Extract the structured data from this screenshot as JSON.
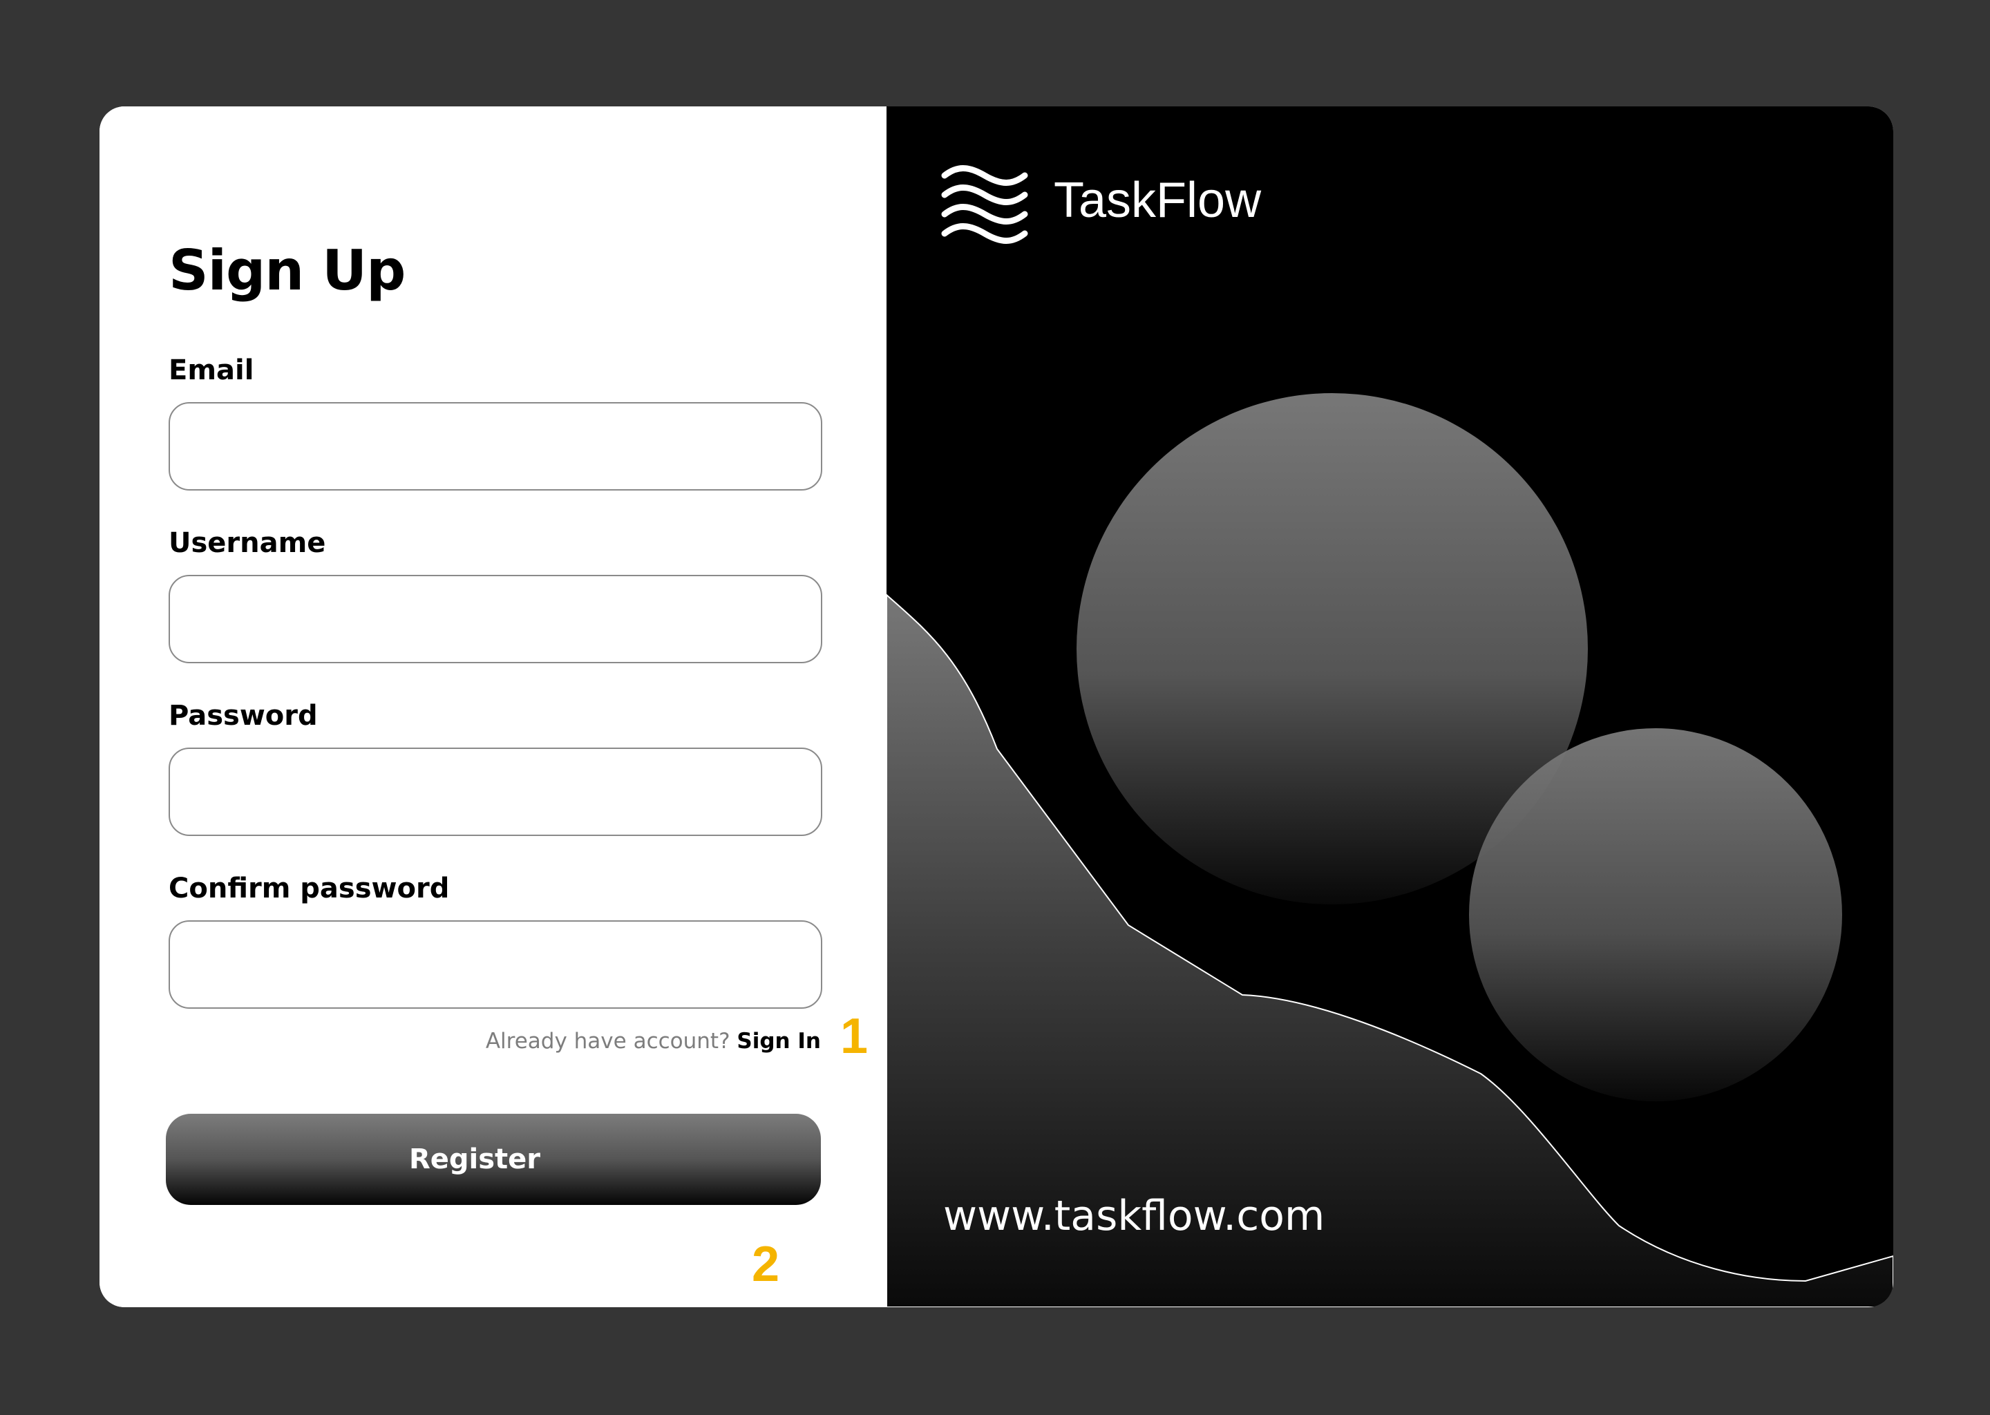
{
  "signup": {
    "title": "Sign Up",
    "fields": [
      {
        "label": "Email",
        "value": "",
        "placeholder": ""
      },
      {
        "label": "Username",
        "value": "",
        "placeholder": ""
      },
      {
        "label": "Password",
        "value": "",
        "placeholder": ""
      },
      {
        "label": "Confirm password",
        "value": "",
        "placeholder": ""
      }
    ],
    "account_prompt": "Already have account?",
    "signin_link": "Sign In",
    "register_label": "Register",
    "annotations": [
      "1",
      "2"
    ]
  },
  "hero": {
    "brand": "TaskFlow",
    "url": "www.taskflow.com",
    "logo_icon": "waves-icon"
  },
  "colors": {
    "page_bg": "#353535",
    "panel_dark": "#000000",
    "accent_annotation": "#f5b400",
    "muted_text": "#7d7d7d"
  }
}
